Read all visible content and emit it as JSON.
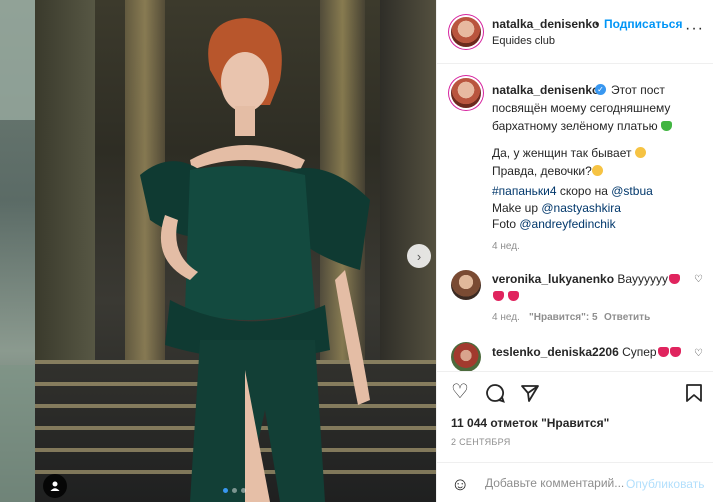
{
  "post": {
    "author": "natalka_denisenko",
    "follow_dot": "•",
    "follow_label": "Подписаться",
    "location": "Equides club",
    "more_icon": "more-horizontal-icon"
  },
  "caption": {
    "author": "natalka_denisenko",
    "lines": [
      "Этот пост",
      "посвящён моему сегодняшнему",
      "бархатному зелёному платью",
      "Да, у женщин так бывает",
      "Правда, девочки?"
    ],
    "hashtag": "#папаньки4",
    "soon_on": " скоро на ",
    "mention_channel": "@stbua",
    "makeup_label": "Make up ",
    "mention_makeup": "@nastyashkira",
    "photo_label": "Foto ",
    "mention_photo": "@andreyfedinchik",
    "age": "4 нед."
  },
  "comments": [
    {
      "user": "veronika_lukyanenko",
      "text": " Вауууууу",
      "age": "4 нед.",
      "likes": "\"Нравится\": 5",
      "reply": "Ответить"
    },
    {
      "user": "teslenko_deniska2206",
      "text": " Супер"
    }
  ],
  "actions": {
    "like_icon": "heart-icon",
    "comment_icon": "comment-icon",
    "share_icon": "paper-plane-icon",
    "save_icon": "bookmark-icon"
  },
  "likes": "11 044 отметок \"Нравится\"",
  "date": "2 СЕНТЯБРЯ",
  "add_comment": {
    "placeholder": "Добавьте комментарий...",
    "publish": "Опубликовать"
  },
  "colors": {
    "accent": "#0095f6",
    "muted": "#8e8e8e",
    "text": "#262626",
    "heart": "#e0245e"
  }
}
